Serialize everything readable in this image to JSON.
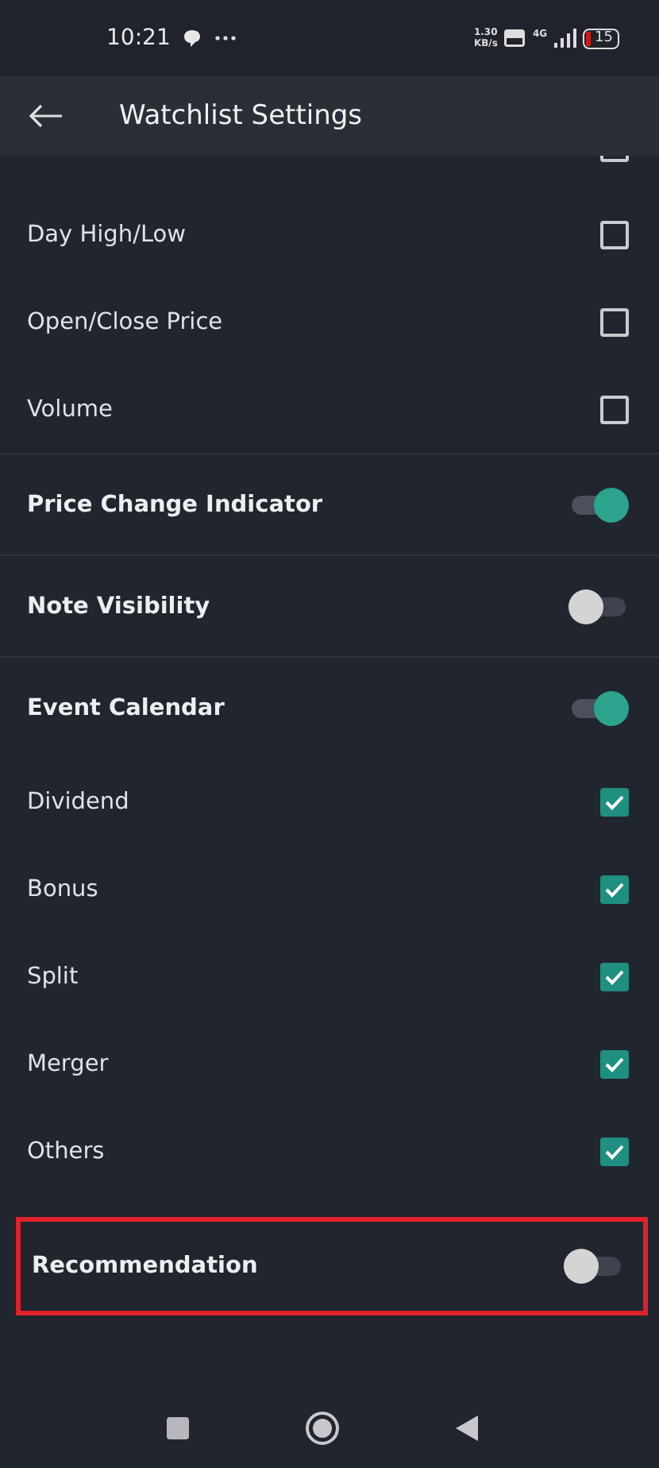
{
  "status_bar": {
    "time": "10:21",
    "speed": [
      "1.30",
      "KB/s"
    ],
    "network": "4G",
    "battery": "15"
  },
  "header": {
    "title": "Watchlist Settings"
  },
  "sections": [
    {
      "items": [
        {
          "kind": "checkbox",
          "checked": false,
          "clipped": true
        },
        {
          "kind": "checkbox",
          "label": "Day High/Low",
          "checked": false
        },
        {
          "kind": "checkbox",
          "label": "Open/Close Price",
          "checked": false
        },
        {
          "kind": "checkbox",
          "label": "Volume",
          "checked": false
        }
      ]
    },
    {
      "items": [
        {
          "kind": "toggle",
          "label": "Price Change Indicator",
          "on": true
        }
      ]
    },
    {
      "items": [
        {
          "kind": "toggle",
          "label": "Note Visibility",
          "on": false
        }
      ]
    },
    {
      "items": [
        {
          "kind": "toggle",
          "label": "Event Calendar",
          "on": true
        },
        {
          "kind": "checkbox",
          "label": "Dividend",
          "checked": true
        },
        {
          "kind": "checkbox",
          "label": "Bonus",
          "checked": true
        },
        {
          "kind": "checkbox",
          "label": "Split",
          "checked": true
        },
        {
          "kind": "checkbox",
          "label": "Merger",
          "checked": true
        },
        {
          "kind": "checkbox",
          "label": "Others",
          "checked": true
        },
        {
          "kind": "toggle",
          "label": "Recommendation",
          "on": false,
          "highlighted": true
        }
      ]
    }
  ]
}
